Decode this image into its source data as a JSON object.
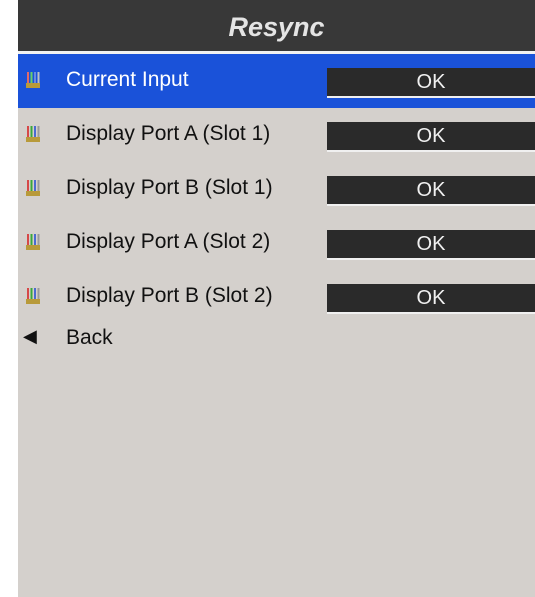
{
  "title": "Resync",
  "rows": [
    {
      "label": "Current Input",
      "status": "OK",
      "selected": true,
      "icon": "connector-pins-icon"
    },
    {
      "label": "Display Port A (Slot 1)",
      "status": "OK",
      "selected": false,
      "icon": "connector-pins-icon"
    },
    {
      "label": "Display Port B (Slot 1)",
      "status": "OK",
      "selected": false,
      "icon": "connector-pins-icon"
    },
    {
      "label": "Display Port A (Slot 2)",
      "status": "OK",
      "selected": false,
      "icon": "connector-pins-icon"
    },
    {
      "label": "Display Port B (Slot 2)",
      "status": "OK",
      "selected": false,
      "icon": "connector-pins-icon"
    }
  ],
  "back": {
    "arrow": "◀",
    "label": "Back",
    "icon": "back-arrow-icon"
  },
  "colors": {
    "panel_bg": "#d4d0cc",
    "title_bg": "#383838",
    "selected_bg": "#1a52d9",
    "status_bg": "#2a2a2a"
  }
}
